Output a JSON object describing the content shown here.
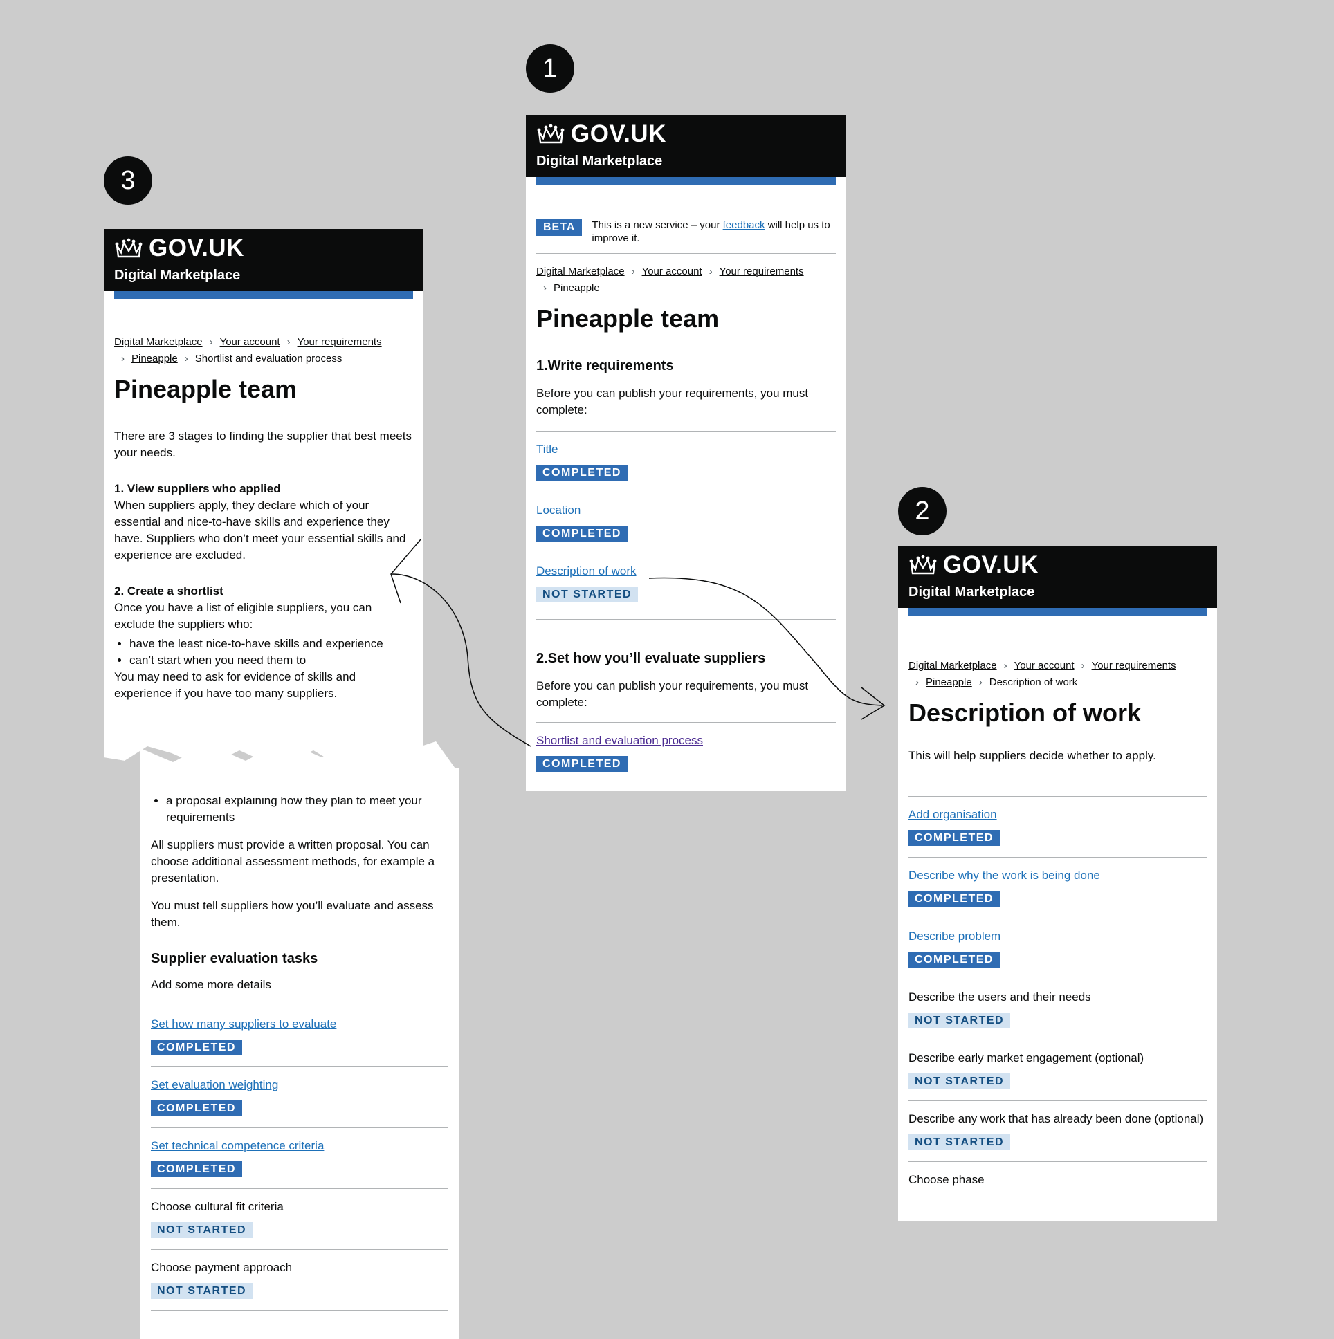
{
  "badges": {
    "one": "1",
    "two": "2",
    "three": "3"
  },
  "header": {
    "logotype": "GOV.UK",
    "service": "Digital Marketplace"
  },
  "screen1": {
    "beta_tag": "BETA",
    "beta_pre": "This is a new service – your ",
    "beta_link": "feedback",
    "beta_post": " will help us to improve it.",
    "crumbs": [
      "Digital Marketplace",
      "Your account",
      "Your requirements",
      "Pineapple"
    ],
    "title": "Pineapple team",
    "sec1_heading": "1.Write requirements",
    "sec1_intro": "Before you can publish your requirements, you must complete:",
    "tasks1": [
      {
        "label": "Title",
        "status": "COMPLETED"
      },
      {
        "label": "Location",
        "status": "COMPLETED"
      },
      {
        "label": "Description of work",
        "status": "NOT STARTED"
      }
    ],
    "sec2_heading": "2.Set how you’ll evaluate suppliers",
    "sec2_intro": "Before you can publish your requirements, you must complete:",
    "tasks2": [
      {
        "label": "Shortlist and evaluation process",
        "status": "COMPLETED"
      }
    ]
  },
  "screen2": {
    "crumbs": [
      "Digital Marketplace",
      "Your account",
      "Your requirements",
      "Pineapple",
      "Description of work"
    ],
    "title": "Description of work",
    "intro": "This will help suppliers decide whether to apply.",
    "tasks": [
      {
        "label": "Add organisation",
        "status": "COMPLETED"
      },
      {
        "label": "Describe why the work is being done",
        "status": "COMPLETED"
      },
      {
        "label": "Describe problem",
        "status": "COMPLETED"
      },
      {
        "label": "Describe the users and their needs",
        "status": "NOT STARTED"
      },
      {
        "label": "Describe early market engagement (optional)",
        "status": "NOT STARTED"
      },
      {
        "label": "Describe any work that has already been done (optional)",
        "status": "NOT STARTED"
      },
      {
        "label": "Choose phase"
      }
    ]
  },
  "screen3": {
    "crumbs": [
      "Digital Marketplace",
      "Your account",
      "Your requirements",
      "Pineapple",
      "Shortlist and evaluation process"
    ],
    "title": "Pineapple team",
    "intro": "There are 3 stages to finding the supplier that best meets your needs.",
    "step1_heading": "1. View suppliers who applied",
    "step1_text": "When suppliers apply, they declare which of your essential and nice-to-have skills and experience they have. Suppliers who don’t meet your essential skills and experience are excluded.",
    "step2_heading": "2. Create a shortlist",
    "step2_text": "Once you have a list of eligible suppliers, you can exclude the suppliers who:",
    "step2_bullets": [
      "have the least nice-to-have skills and experience",
      "can’t start when you need them to"
    ],
    "step2_after": "You may need to ask for evidence of skills and experience if you have too many suppliers."
  },
  "screen3b": {
    "bullets": [
      "a proposal explaining how they plan to meet your requirements"
    ],
    "para1": "All suppliers must provide a written proposal. You can choose additional assessment methods, for example a presentation.",
    "para2": "You must tell suppliers how you’ll evaluate and assess them.",
    "heading": "Supplier evaluation tasks",
    "sub": "Add some more details",
    "tasks": [
      {
        "label": "Set how many suppliers to evaluate",
        "status": "COMPLETED"
      },
      {
        "label": "Set evaluation weighting",
        "status": "COMPLETED"
      },
      {
        "label": "Set technical competence criteria",
        "status": "COMPLETED"
      },
      {
        "label": "Choose cultural fit criteria",
        "status": "NOT STARTED"
      },
      {
        "label": "Choose payment approach",
        "status": "NOT STARTED"
      }
    ]
  }
}
